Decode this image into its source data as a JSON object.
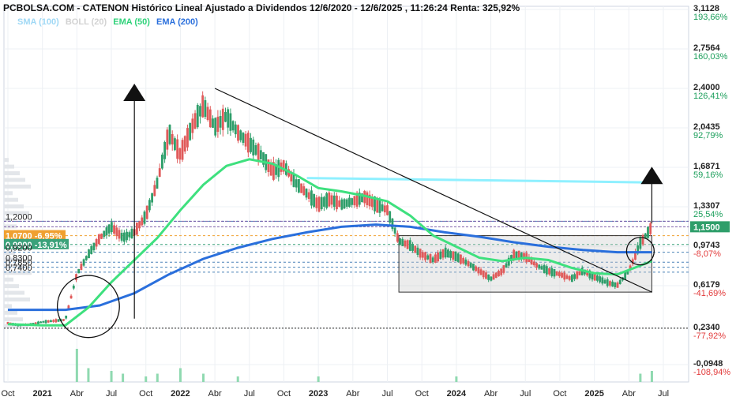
{
  "header": {
    "title": "PCBOLSA.COM - CATENON Histórico Lineal Ajustado a Dividendos 12/6/2020 - 12/6/2025 , 11:26:24 Renta: 325,92%"
  },
  "legend": [
    {
      "label": "SMA (100)",
      "color": "#9fd8f5"
    },
    {
      "label": "BOLL (20)",
      "color": "#d2d2d2"
    },
    {
      "label": "EMA (50)",
      "color": "#2fd27a"
    },
    {
      "label": "EMA (200)",
      "color": "#2a6fdc"
    }
  ],
  "colors": {
    "up": "#2e9e6a",
    "down": "#e05a5a",
    "ema50": "#3ee07e",
    "ema200": "#2a6fdc",
    "sma100": "#8ff0ff",
    "orange": "#f0a030",
    "pct_up": "#1a9e5a",
    "pct_down": "#e23b3b"
  },
  "chart_data": {
    "type": "candlestick",
    "title": "CATENON Histórico Lineal Ajustado a Dividendos",
    "x_range": [
      "2020-10",
      "2025-07"
    ],
    "y_range": [
      -0.11,
      3.1128
    ],
    "x_ticks": [
      {
        "label": "Oct",
        "date": "2020-10",
        "bold": false
      },
      {
        "label": "2021",
        "date": "2021-01",
        "bold": true
      },
      {
        "label": "Abr",
        "date": "2021-04",
        "bold": false
      },
      {
        "label": "Jul",
        "date": "2021-07",
        "bold": false
      },
      {
        "label": "Oct",
        "date": "2021-10",
        "bold": false
      },
      {
        "label": "2022",
        "date": "2022-01",
        "bold": true
      },
      {
        "label": "Abr",
        "date": "2022-04",
        "bold": false
      },
      {
        "label": "Jul",
        "date": "2022-07",
        "bold": false
      },
      {
        "label": "Oct",
        "date": "2022-10",
        "bold": false
      },
      {
        "label": "2023",
        "date": "2023-01",
        "bold": true
      },
      {
        "label": "Abr",
        "date": "2023-04",
        "bold": false
      },
      {
        "label": "Jul",
        "date": "2023-07",
        "bold": false
      },
      {
        "label": "Oct",
        "date": "2023-10",
        "bold": false
      },
      {
        "label": "2024",
        "date": "2024-01",
        "bold": true
      },
      {
        "label": "Abr",
        "date": "2024-04",
        "bold": false
      },
      {
        "label": "Jul",
        "date": "2024-07",
        "bold": false
      },
      {
        "label": "Oct",
        "date": "2024-10",
        "bold": false
      },
      {
        "label": "2025",
        "date": "2025-01",
        "bold": true
      },
      {
        "label": "Abr",
        "date": "2025-04",
        "bold": false
      },
      {
        "label": "Jul",
        "date": "2025-07",
        "bold": false
      }
    ],
    "y_ticks_right": [
      {
        "value": 3.1128,
        "price": "3,1128",
        "pct": "193,66%",
        "dir": "up"
      },
      {
        "value": 2.7564,
        "price": "2,7564",
        "pct": "160,03%",
        "dir": "up"
      },
      {
        "value": 2.4,
        "price": "2,4000",
        "pct": "126,41%",
        "dir": "up"
      },
      {
        "value": 2.0435,
        "price": "2,0435",
        "pct": "92,79%",
        "dir": "up"
      },
      {
        "value": 1.6871,
        "price": "1,6871",
        "pct": "59,16%",
        "dir": "up"
      },
      {
        "value": 1.3307,
        "price": "1,3307",
        "pct": "25,54%",
        "dir": "up"
      },
      {
        "value": 0.9743,
        "price": "0,9743",
        "pct": "-8,07%",
        "dir": "down"
      },
      {
        "value": 0.6179,
        "price": "0,6179",
        "pct": "-41,69%",
        "dir": "down"
      },
      {
        "value": 0.234,
        "price": "0,2340",
        "pct": "-77,92%",
        "dir": "down"
      },
      {
        "value": -0.0948,
        "price": "-0,0948",
        "pct": "-108,94%",
        "dir": "down"
      }
    ],
    "current_price": {
      "value": 1.15,
      "label": "1,1500"
    },
    "left_levels": [
      {
        "value": 1.2,
        "label": "1,2000",
        "style": "plain"
      },
      {
        "value": 1.07,
        "label": "1,0700 -6,95%",
        "style": "orange"
      },
      {
        "value": 0.99,
        "label": "0,9900 -13,91%",
        "style": "green"
      },
      {
        "value": 0.92,
        "label": "0,9200",
        "style": "plain"
      },
      {
        "value": 0.83,
        "label": "0,8300",
        "style": "plain"
      },
      {
        "value": 0.785,
        "label": "0,7850",
        "style": "plain"
      },
      {
        "value": 0.74,
        "label": "0,7400",
        "style": "plain"
      }
    ],
    "price_path": [
      [
        "2020-10",
        0.28
      ],
      [
        "2020-11",
        0.26
      ],
      [
        "2020-12",
        0.27
      ],
      [
        "2021-01",
        0.29
      ],
      [
        "2021-02",
        0.3
      ],
      [
        "2021-03",
        0.31
      ],
      [
        "2021-04",
        0.72
      ],
      [
        "2021-05",
        0.9
      ],
      [
        "2021-06",
        1.05
      ],
      [
        "2021-07",
        1.15
      ],
      [
        "2021-08",
        1.05
      ],
      [
        "2021-09",
        1.1
      ],
      [
        "2021-10",
        1.25
      ],
      [
        "2021-11",
        1.55
      ],
      [
        "2021-12",
        2.0
      ],
      [
        "2022-01",
        1.8
      ],
      [
        "2022-02",
        2.05
      ],
      [
        "2022-03",
        2.25
      ],
      [
        "2022-04",
        2.05
      ],
      [
        "2022-05",
        2.15
      ],
      [
        "2022-06",
        2.0
      ],
      [
        "2022-07",
        1.9
      ],
      [
        "2022-08",
        1.8
      ],
      [
        "2022-09",
        1.65
      ],
      [
        "2022-10",
        1.7
      ],
      [
        "2022-11",
        1.55
      ],
      [
        "2022-12",
        1.45
      ],
      [
        "2023-01",
        1.35
      ],
      [
        "2023-02",
        1.4
      ],
      [
        "2023-03",
        1.35
      ],
      [
        "2023-04",
        1.38
      ],
      [
        "2023-05",
        1.42
      ],
      [
        "2023-06",
        1.35
      ],
      [
        "2023-07",
        1.3
      ],
      [
        "2023-08",
        1.02
      ],
      [
        "2023-09",
        0.98
      ],
      [
        "2023-10",
        0.9
      ],
      [
        "2023-11",
        0.85
      ],
      [
        "2023-12",
        0.92
      ],
      [
        "2024-01",
        0.88
      ],
      [
        "2024-02",
        0.82
      ],
      [
        "2024-03",
        0.75
      ],
      [
        "2024-04",
        0.68
      ],
      [
        "2024-05",
        0.75
      ],
      [
        "2024-06",
        0.9
      ],
      [
        "2024-07",
        0.88
      ],
      [
        "2024-08",
        0.8
      ],
      [
        "2024-09",
        0.75
      ],
      [
        "2024-10",
        0.72
      ],
      [
        "2024-11",
        0.68
      ],
      [
        "2024-12",
        0.75
      ],
      [
        "2025-01",
        0.7
      ],
      [
        "2025-02",
        0.65
      ],
      [
        "2025-03",
        0.62
      ],
      [
        "2025-04",
        0.75
      ],
      [
        "2025-05",
        1.0
      ],
      [
        "2025-06",
        1.15
      ]
    ],
    "ema50": [
      [
        "2020-10",
        0.27
      ],
      [
        "2021-01",
        0.26
      ],
      [
        "2021-03",
        0.26
      ],
      [
        "2021-05",
        0.42
      ],
      [
        "2021-07",
        0.65
      ],
      [
        "2021-09",
        0.85
      ],
      [
        "2021-11",
        1.05
      ],
      [
        "2022-01",
        1.3
      ],
      [
        "2022-03",
        1.53
      ],
      [
        "2022-05",
        1.7
      ],
      [
        "2022-07",
        1.76
      ],
      [
        "2022-09",
        1.72
      ],
      [
        "2022-11",
        1.62
      ],
      [
        "2023-01",
        1.5
      ],
      [
        "2023-03",
        1.47
      ],
      [
        "2023-05",
        1.43
      ],
      [
        "2023-07",
        1.38
      ],
      [
        "2023-09",
        1.25
      ],
      [
        "2023-11",
        1.07
      ],
      [
        "2024-01",
        0.97
      ],
      [
        "2024-03",
        0.87
      ],
      [
        "2024-05",
        0.84
      ],
      [
        "2024-07",
        0.87
      ],
      [
        "2024-09",
        0.85
      ],
      [
        "2024-11",
        0.78
      ],
      [
        "2025-01",
        0.73
      ],
      [
        "2025-03",
        0.72
      ],
      [
        "2025-05",
        0.8
      ],
      [
        "2025-06",
        0.84
      ]
    ],
    "ema200": [
      [
        "2020-10",
        0.4
      ],
      [
        "2021-01",
        0.4
      ],
      [
        "2021-03",
        0.4
      ],
      [
        "2021-06",
        0.44
      ],
      [
        "2021-09",
        0.55
      ],
      [
        "2021-12",
        0.72
      ],
      [
        "2022-03",
        0.86
      ],
      [
        "2022-06",
        0.96
      ],
      [
        "2022-09",
        1.04
      ],
      [
        "2022-12",
        1.1
      ],
      [
        "2023-03",
        1.15
      ],
      [
        "2023-06",
        1.17
      ],
      [
        "2023-09",
        1.15
      ],
      [
        "2023-12",
        1.1
      ],
      [
        "2024-03",
        1.06
      ],
      [
        "2024-06",
        1.01
      ],
      [
        "2024-09",
        0.97
      ],
      [
        "2024-12",
        0.94
      ],
      [
        "2025-03",
        0.92
      ],
      [
        "2025-06",
        0.92
      ]
    ],
    "sma100": [
      [
        "2022-12",
        1.59
      ],
      [
        "2025-06",
        1.55
      ]
    ],
    "volume": [
      [
        "2021-04",
        0.12
      ],
      [
        "2021-05",
        0.05
      ],
      [
        "2021-07",
        0.04
      ],
      [
        "2021-08",
        0.03
      ],
      [
        "2021-10",
        0.02
      ],
      [
        "2021-11",
        0.03
      ],
      [
        "2022-01",
        0.05
      ],
      [
        "2022-03",
        0.03
      ],
      [
        "2022-06",
        0.02
      ],
      [
        "2023-01",
        0.02
      ],
      [
        "2024-01",
        0.02
      ],
      [
        "2025-05",
        0.03
      ],
      [
        "2025-06",
        0.04
      ]
    ],
    "annotations": {
      "trendline": [
        [
          "2022-04",
          2.4
        ],
        [
          "2025-06",
          0.56
        ]
      ],
      "range_box": {
        "x0": "2023-08",
        "x1": "2025-06",
        "y0": 0.56,
        "y1": 1.07
      },
      "circles": [
        {
          "center": [
            "2021-05",
            0.43
          ],
          "r_months": 2.7
        },
        {
          "center": [
            "2025-05",
            0.93
          ],
          "r_months": 1.2
        }
      ],
      "arrows": [
        {
          "x": "2021-09",
          "y0": 0.32,
          "y1": 2.3
        },
        {
          "x": "2025-06",
          "y0": 1.18,
          "y1": 1.55
        }
      ],
      "baseline_dotted": 0.234
    }
  }
}
